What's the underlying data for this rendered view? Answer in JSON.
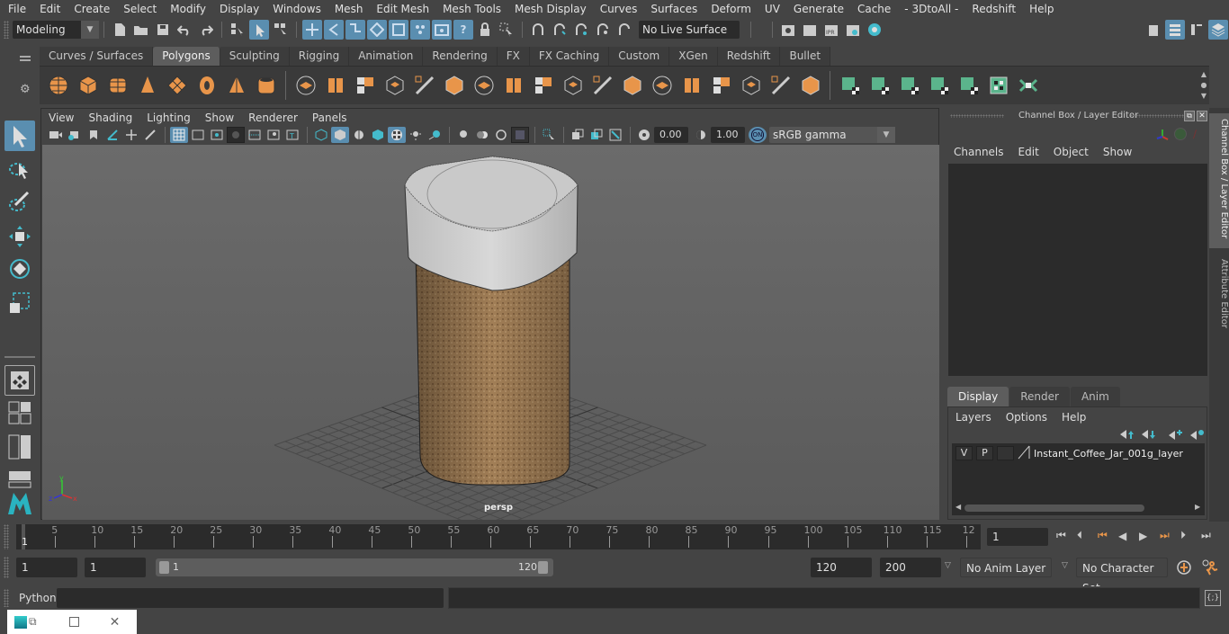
{
  "menubar": {
    "items": [
      "File",
      "Edit",
      "Create",
      "Select",
      "Modify",
      "Display",
      "Windows",
      "Mesh",
      "Edit Mesh",
      "Mesh Tools",
      "Mesh Display",
      "Curves",
      "Surfaces",
      "Deform",
      "UV",
      "Generate",
      "Cache",
      "- 3DtoAll -",
      "Redshift",
      "Help"
    ]
  },
  "statusline": {
    "mode_selector": "Modeling",
    "live_surface": "No Live Surface"
  },
  "shelf": {
    "tabs": [
      {
        "label": "Curves / Surfaces",
        "active": false
      },
      {
        "label": "Polygons",
        "active": true
      },
      {
        "label": "Sculpting",
        "active": false
      },
      {
        "label": "Rigging",
        "active": false
      },
      {
        "label": "Animation",
        "active": false
      },
      {
        "label": "Rendering",
        "active": false
      },
      {
        "label": "FX",
        "active": false
      },
      {
        "label": "FX Caching",
        "active": false
      },
      {
        "label": "Custom",
        "active": false
      },
      {
        "label": "XGen",
        "active": false
      },
      {
        "label": "Redshift",
        "active": false
      },
      {
        "label": "Bullet",
        "active": false
      }
    ],
    "orange_icons": [
      "poly-sphere",
      "poly-cube",
      "poly-cylinder",
      "poly-cone",
      "poly-plane",
      "poly-torus",
      "poly-pyramid",
      "poly-pipe"
    ],
    "edit_icons": [
      "combine",
      "separate",
      "mirror",
      "smooth",
      "boolean",
      "extract",
      "bevel",
      "bridge",
      "extrude",
      "append",
      "multi-cut",
      "insert-edge-loop",
      "offset-edge-loop",
      "target-weld",
      "merge",
      "fill-hole",
      "reduce",
      "triangulate"
    ],
    "uv_icons": [
      "planar-map",
      "cylindrical-map",
      "spherical-map",
      "automatic-map",
      "unfold",
      "uv-editor",
      "layout-uv"
    ],
    "accent_orange": "#e8954a",
    "accent_green": "#5bb48c"
  },
  "viewport": {
    "menu": [
      "View",
      "Shading",
      "Lighting",
      "Show",
      "Renderer",
      "Panels"
    ],
    "exposure": "0.00",
    "gamma": "1.00",
    "color_mgmt_badge": "ON",
    "color_space": "sRGB gamma",
    "camera_label": "persp",
    "axis": {
      "x": "x",
      "y": "y",
      "z": "z"
    }
  },
  "channel_box": {
    "title": "Channel Box / Layer Editor",
    "menu": [
      "Channels",
      "Edit",
      "Object",
      "Show"
    ]
  },
  "layer_editor": {
    "tabs": [
      {
        "label": "Display",
        "active": true
      },
      {
        "label": "Render",
        "active": false
      },
      {
        "label": "Anim",
        "active": false
      }
    ],
    "menu": [
      "Layers",
      "Options",
      "Help"
    ],
    "layers": [
      {
        "visible": "V",
        "playback": "P",
        "name": "Instant_Coffee_Jar_001g_layer"
      }
    ]
  },
  "side_tabs": [
    "Channel Box / Layer Editor",
    "Attribute Editor"
  ],
  "timeline": {
    "ticks": [
      "5",
      "10",
      "15",
      "20",
      "25",
      "30",
      "35",
      "40",
      "45",
      "50",
      "55",
      "60",
      "65",
      "70",
      "75",
      "80",
      "85",
      "90",
      "95",
      "100",
      "105",
      "110",
      "115",
      "12"
    ],
    "current_frame_marker": "1",
    "current_frame": "1"
  },
  "range": {
    "start": "1",
    "playback_start": "1",
    "slider_min": "1",
    "slider_max": "120",
    "playback_end": "120",
    "end": "200",
    "anim_layer": "No Anim Layer",
    "character_set": "No Character Set"
  },
  "command": {
    "language": "Python",
    "input": "",
    "result": ""
  }
}
